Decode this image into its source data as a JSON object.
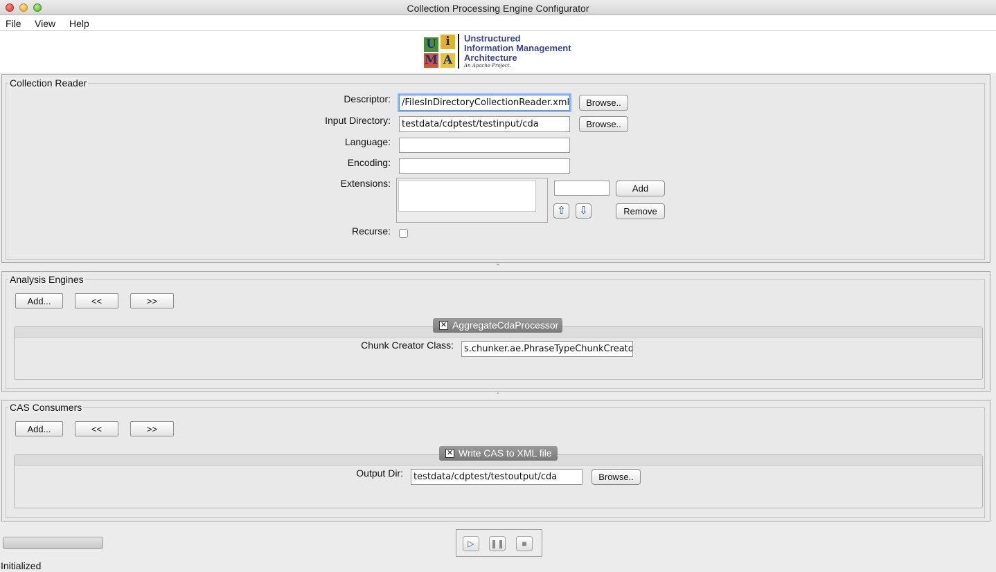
{
  "window": {
    "title": "Collection Processing Engine Configurator"
  },
  "menu": {
    "items": [
      "File",
      "View",
      "Help"
    ]
  },
  "logo": {
    "tiles": [
      "U",
      "i",
      "M",
      "A"
    ],
    "lines": [
      "Unstructured",
      "Information Management",
      "Architecture"
    ],
    "tagline": "An Apache Project."
  },
  "collection_reader": {
    "title": "Collection Reader",
    "descriptor": {
      "label": "Descriptor:",
      "value": "/FilesInDirectoryCollectionReader.xml",
      "browse": "Browse.."
    },
    "input_directory": {
      "label": "Input Directory:",
      "value": "testdata/cdptest/testinput/cda",
      "browse": "Browse.."
    },
    "language": {
      "label": "Language:",
      "value": ""
    },
    "encoding": {
      "label": "Encoding:",
      "value": ""
    },
    "extensions": {
      "label": "Extensions:",
      "entry_value": "",
      "add": "Add",
      "remove": "Remove",
      "up_icon": "arrow-up-icon",
      "down_icon": "arrow-down-icon"
    },
    "recurse": {
      "label": "Recurse:",
      "checked": false
    }
  },
  "analysis_engines": {
    "title": "Analysis Engines",
    "add": "Add...",
    "move_left": "<<",
    "move_right": ">>",
    "tab": {
      "name": "AggregateCdaProcessor",
      "close_icon": "close-icon",
      "field_label": "Chunk Creator Class:",
      "field_value": "s.chunker.ae.PhraseTypeChunkCreator"
    }
  },
  "cas_consumers": {
    "title": "CAS Consumers",
    "add": "Add...",
    "move_left": "<<",
    "move_right": ">>",
    "tab": {
      "name": "Write CAS to XML file",
      "close_icon": "close-icon",
      "field_label": "Output Dir:",
      "field_value": "testdata/cdptest/testoutput/cda",
      "browse": "Browse.."
    }
  },
  "controls": {
    "play_icon": "play-icon",
    "pause_icon": "pause-icon",
    "stop_icon": "stop-icon"
  },
  "status": {
    "text": "Initialized"
  }
}
